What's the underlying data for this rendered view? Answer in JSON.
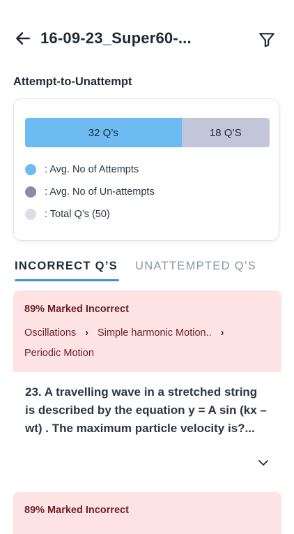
{
  "header": {
    "title": "16-09-23_Super60-..."
  },
  "section": {
    "title": "Attempt-to-Unattempt"
  },
  "summary": {
    "attempts_label": "32 Q’s",
    "unattempts_label": "18 Q’S",
    "attempts_value": 32,
    "total_value": 50,
    "legend": [
      {
        "color": "#6dbbf2",
        "label": ": Avg. No of Attempts"
      },
      {
        "color": "#8a8ba6",
        "label": ": Avg. No of Un-attempts"
      },
      {
        "color": "#dcdde9",
        "label": ": Total Q’s (50)"
      }
    ]
  },
  "tabs": {
    "incorrect": "INCORRECT Q’S",
    "unattempted": "UNATTEMPTED Q’S"
  },
  "questions": [
    {
      "tag": "89% Marked Incorrect",
      "crumbs": [
        "Oscillations",
        "Simple harmonic Motion..",
        "Periodic Motion"
      ],
      "text": "23. A travelling wave in a stretched string is described by the equation y = A sin (kx – wt) . The maximum particle velocity is?..."
    },
    {
      "tag": "89% Marked Incorrect"
    }
  ]
}
